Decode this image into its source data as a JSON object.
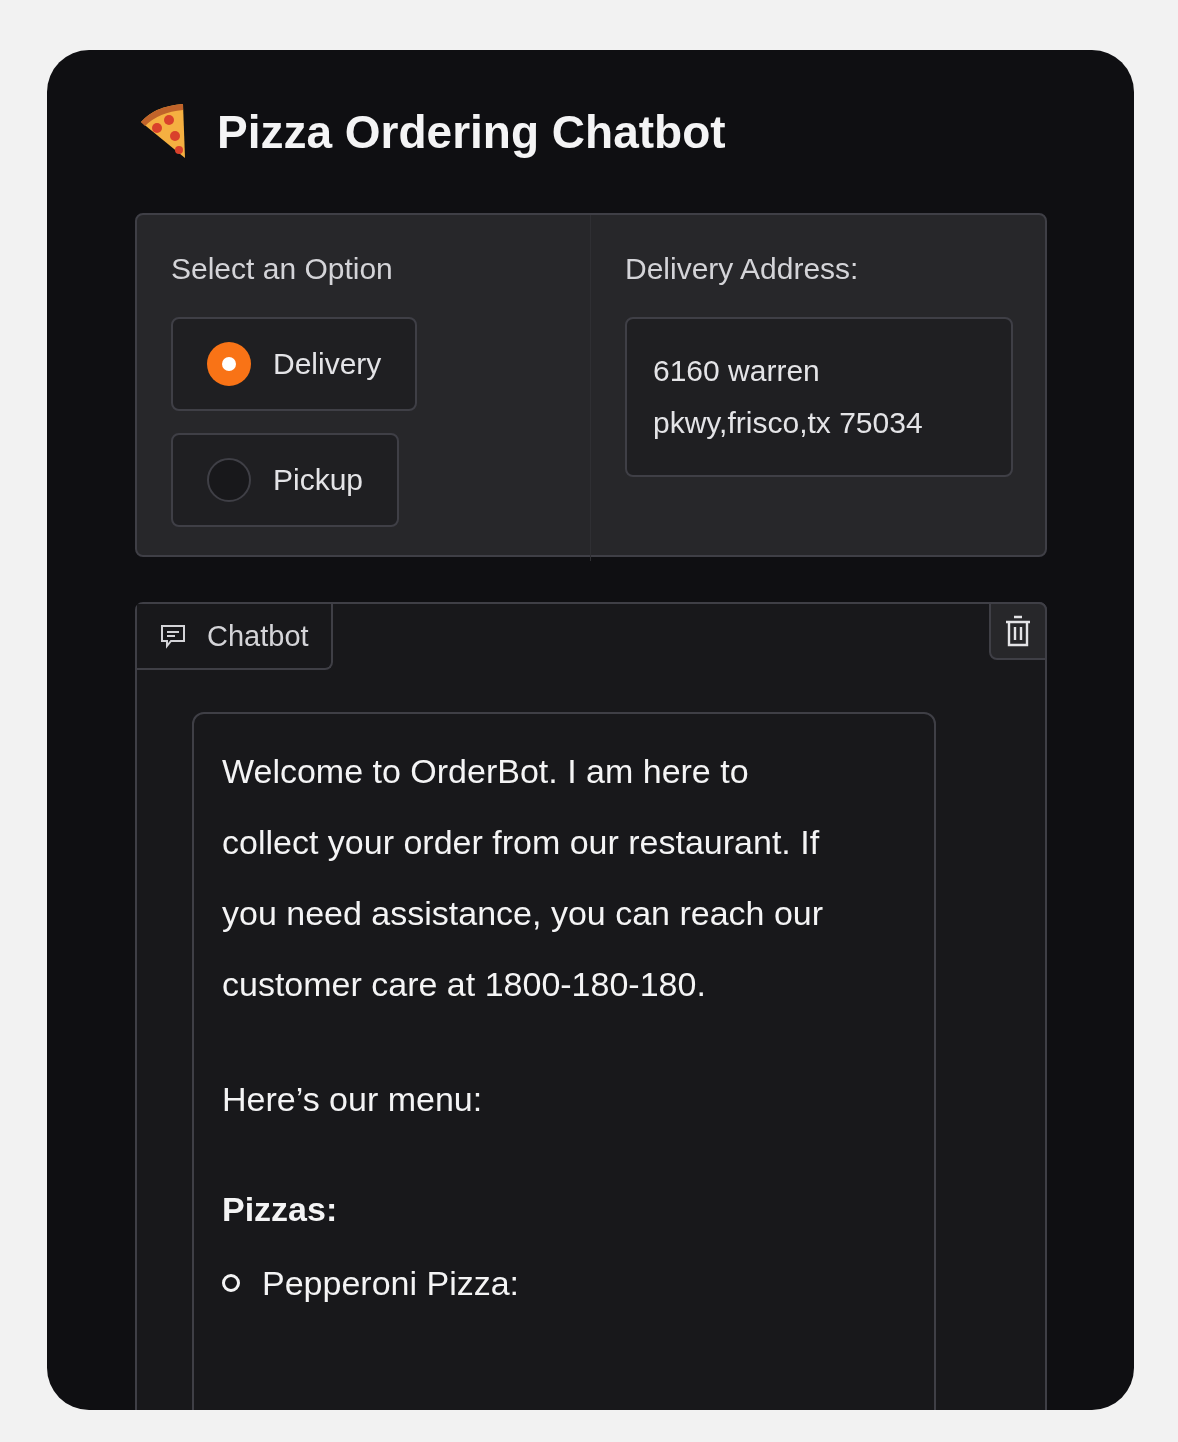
{
  "title": "Pizza Ordering Chatbot",
  "option_group": {
    "label": "Select an Option",
    "options": [
      {
        "label": "Delivery",
        "selected": true
      },
      {
        "label": "Pickup",
        "selected": false
      }
    ]
  },
  "address": {
    "label": "Delivery Address:",
    "value": "6160 warren pkwy,frisco,tx 75034"
  },
  "chatbot": {
    "tab": "Chatbot",
    "message": {
      "paragraphs": [
        "Welcome to OrderBot. I am here to collect your order from our restaurant. If you need assistance, you can reach our customer care at 1800-180-180.",
        "Here’s our menu:"
      ],
      "section": "Pizzas:",
      "items": [
        "Pepperoni Pizza:"
      ]
    }
  }
}
